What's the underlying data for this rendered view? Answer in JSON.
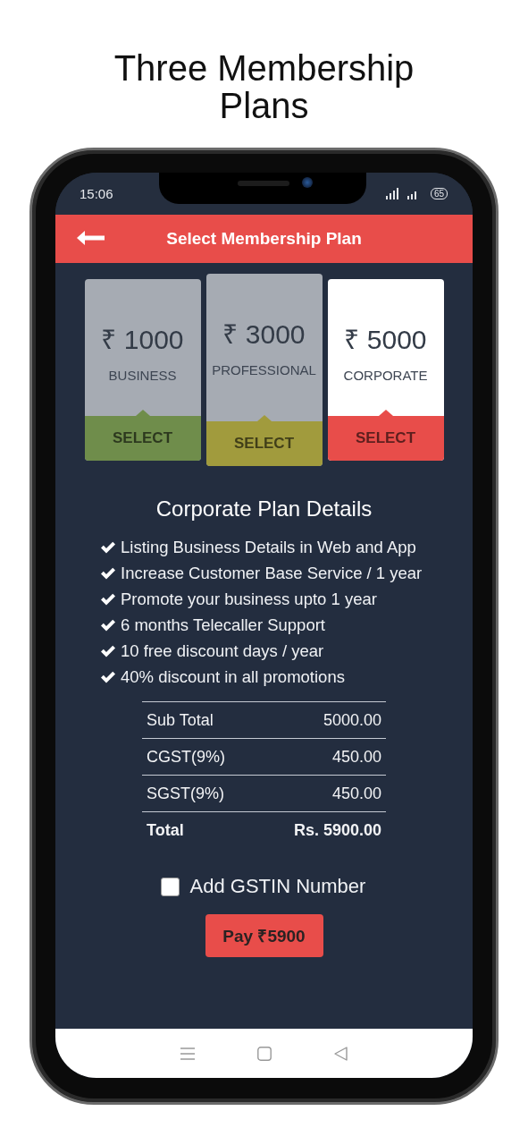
{
  "heading": "Three Membership Plans",
  "status_bar": {
    "time": "15:06",
    "battery": "65"
  },
  "app_bar": {
    "title": "Select Membership Plan"
  },
  "plans": [
    {
      "price": "₹ 1000",
      "name": "BUSINESS",
      "button": "SELECT",
      "color": "#6f8d4b",
      "selected": false,
      "raised": false
    },
    {
      "price": "₹ 3000",
      "name": "PROFESSIONAL",
      "button": "SELECT",
      "color": "#a19b3d",
      "selected": false,
      "raised": true
    },
    {
      "price": "₹ 5000",
      "name": "CORPORATE",
      "button": "SELECT",
      "color": "#e84d4a",
      "selected": true,
      "raised": false
    }
  ],
  "details": {
    "title": "Corporate Plan Details",
    "features": [
      "Listing Business Details in Web and App",
      "Increase Customer Base Service / 1 year",
      "Promote your business upto 1 year",
      "6 months Telecaller Support",
      "10 free discount days / year",
      "40% discount in all promotions"
    ]
  },
  "summary": [
    {
      "label": "Sub Total",
      "value": "5000.00",
      "kind": "line"
    },
    {
      "label": "CGST(9%)",
      "value": "450.00",
      "kind": "line"
    },
    {
      "label": "SGST(9%)",
      "value": "450.00",
      "kind": "line"
    },
    {
      "label": "Total",
      "value": "Rs. 5900.00",
      "kind": "total"
    }
  ],
  "gstin": {
    "label": "Add GSTIN Number",
    "checked": false
  },
  "pay_button": "Pay ₹5900"
}
